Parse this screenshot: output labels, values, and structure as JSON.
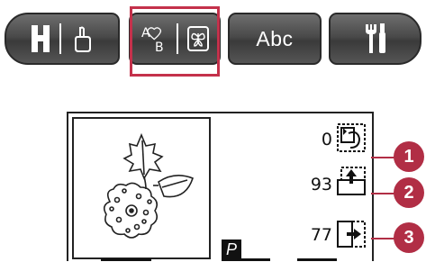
{
  "toolbar": {
    "abc_label": "Abc",
    "icons": [
      "hoop-h-icon",
      "touch-hand-icon",
      "mirror-ab-icon",
      "butterfly-design-icon",
      "tools-icon"
    ],
    "highlight_color": "#c4314b"
  },
  "screen": {
    "rows": [
      {
        "value": "0"
      },
      {
        "value": "93"
      },
      {
        "value": "77"
      }
    ],
    "badge": "P"
  },
  "callouts": [
    "1",
    "2",
    "3"
  ],
  "colors": {
    "accent": "#b12e45",
    "toolbar": "#4a4a4a"
  }
}
